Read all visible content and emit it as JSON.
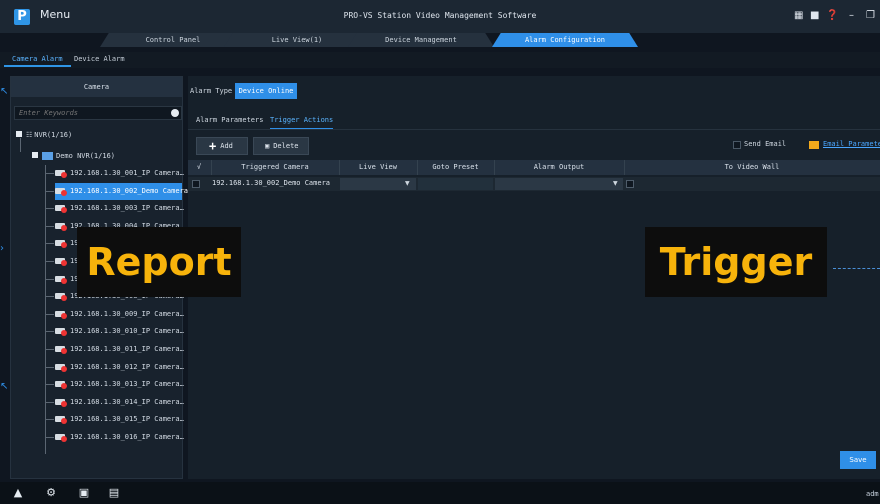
{
  "app": {
    "menu_label": "Menu",
    "logo_glyph": "P",
    "title": "PRO-VS Station Video Management Software",
    "window_controls": [
      "network-icon",
      "lock-icon",
      "help-icon",
      "minimize-icon",
      "restore-icon"
    ]
  },
  "nav_tabs": [
    {
      "label": "Control Panel",
      "active": false
    },
    {
      "label": "Live View(1)",
      "active": false
    },
    {
      "label": "Device Management",
      "active": false
    },
    {
      "label": "Alarm Configuration",
      "active": true
    }
  ],
  "sub_tabs": [
    {
      "label": "Camera Alarm",
      "active": true
    },
    {
      "label": "Device Alarm",
      "active": false
    }
  ],
  "camera_panel": {
    "header": "Camera",
    "search_placeholder": "Enter Keywords",
    "nvr_node": "NVR(1/16)",
    "demo_node": "Demo NVR(1/16)",
    "cameras": [
      "192.168.1.30_001_IP Camera…",
      "192.168.1.30_002_Demo Camera",
      "192.168.1.30_003_IP Camera…",
      "192.168.1.30_004_IP Camera…",
      "192.168.1.30_005_IP Camera…",
      "192.168.1.30_006_IP Camera…",
      "192.168.1.30_007_IP Camera…",
      "192.168.1.30_008_IP Camera…",
      "192.168.1.30_009_IP Camera…",
      "192.168.1.30_010_IP Camera…",
      "192.168.1.30_011_IP Camera…",
      "192.168.1.30_012_IP Camera…",
      "192.168.1.30_013_IP Camera…",
      "192.168.1.30_014_IP Camera…",
      "192.168.1.30_015_IP Camera…",
      "192.168.1.30_016_IP Camera…"
    ],
    "selected_index": 1
  },
  "alarm": {
    "type_label": "Alarm Type",
    "type_value": "Device Online",
    "tab_params": "Alarm Parameters",
    "tab_trigger": "Trigger Actions",
    "add_label": "Add",
    "delete_label": "Delete",
    "send_email_label": "Send Email",
    "email_params_label": "Email Parameter"
  },
  "table": {
    "headers": [
      "√",
      "Triggered Camera",
      "Live View",
      "Goto Preset",
      "Alarm Output",
      "To Video Wall"
    ],
    "rows": [
      {
        "camera": "192.168.1.30_002_Demo Camera",
        "live_view": "",
        "goto_preset": "",
        "alarm_output": "",
        "to_video_wall": ""
      }
    ]
  },
  "save_label": "Save",
  "overlays": {
    "report": "Report",
    "trigger": "Trigger"
  },
  "status": {
    "icons": [
      "alarm-warning-icon",
      "alarm-config-icon",
      "screen-icon",
      "report-icon"
    ],
    "user": "adm"
  },
  "colors": {
    "accent": "#2f8fe8",
    "badge_text": "#f7b30b",
    "badge_bg": "#0d0d0d",
    "background": "#0f1620"
  }
}
